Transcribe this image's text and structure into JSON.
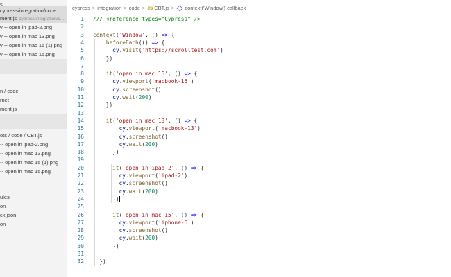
{
  "sidebar": {
    "items": [
      {
        "label": "s",
        "desc": ""
      },
      {
        "label": "cypress/integration/code",
        "desc": ""
      },
      {
        "label": "ment.js",
        "desc": "cypress/integration/c..."
      },
      {
        "label": "v -- open in ipad-2.png",
        "desc": ""
      },
      {
        "label": "v -- open in mac 13.png",
        "desc": ""
      },
      {
        "label": "v -- open in mac 15 (1).png",
        "desc": ""
      },
      {
        "label": "v -- open in mac 15.png",
        "desc": ""
      },
      {
        "label": "n / code",
        "desc": ""
      },
      {
        "label": "rnet",
        "desc": ""
      },
      {
        "label": "ment.js",
        "desc": ""
      },
      {
        "label": "ots / code / CBT.js",
        "desc": ""
      },
      {
        "label": "-- open in ipad-2.png",
        "desc": ""
      },
      {
        "label": "-- open in mac 13.png",
        "desc": ""
      },
      {
        "label": "-- open in mac 15 (1).png",
        "desc": ""
      },
      {
        "label": "-- open in mac 15.png",
        "desc": ""
      },
      {
        "label": "ules",
        "desc": ""
      },
      {
        "label": "on",
        "desc": ""
      },
      {
        "label": "ck.json",
        "desc": ""
      },
      {
        "label": "on",
        "desc": ""
      }
    ]
  },
  "breadcrumb": {
    "parts": [
      "cypress",
      "integration",
      "code",
      "CBT.js",
      "context('Window') callback"
    ],
    "file_icon": "JS"
  },
  "editor": {
    "lines": [
      {
        "n": "1",
        "tokens": [
          {
            "c": "t-com",
            "t": "/// <reference types=\"Cypress\" />"
          }
        ]
      },
      {
        "n": "2",
        "tokens": []
      },
      {
        "n": "3",
        "tokens": [
          {
            "c": "t-fn",
            "t": "context"
          },
          {
            "c": "",
            "t": "("
          },
          {
            "c": "t-str",
            "t": "'Window'"
          },
          {
            "c": "",
            "t": ", () "
          },
          {
            "c": "t-kw",
            "t": "=>"
          },
          {
            "c": "",
            "t": " {"
          }
        ]
      },
      {
        "n": "4",
        "tokens": [
          {
            "c": "",
            "t": "    "
          },
          {
            "c": "t-fn",
            "t": "beforeEach"
          },
          {
            "c": "",
            "t": "(() "
          },
          {
            "c": "t-kw",
            "t": "=>"
          },
          {
            "c": "",
            "t": " {"
          }
        ]
      },
      {
        "n": "5",
        "tokens": [
          {
            "c": "",
            "t": "      "
          },
          {
            "c": "t-var",
            "t": "cy"
          },
          {
            "c": "",
            "t": "."
          },
          {
            "c": "t-fn",
            "t": "visit"
          },
          {
            "c": "",
            "t": "("
          },
          {
            "c": "t-str",
            "t": "'"
          },
          {
            "c": "t-url",
            "t": "https://scrolltest.com"
          },
          {
            "c": "t-str",
            "t": "'"
          },
          {
            "c": "",
            "t": ")"
          }
        ]
      },
      {
        "n": "6",
        "tokens": [
          {
            "c": "",
            "t": "    })"
          }
        ]
      },
      {
        "n": "7",
        "tokens": []
      },
      {
        "n": "8",
        "tokens": [
          {
            "c": "",
            "t": "    "
          },
          {
            "c": "t-fn",
            "t": "it"
          },
          {
            "c": "",
            "t": "("
          },
          {
            "c": "t-str",
            "t": "'open in mac 15'"
          },
          {
            "c": "",
            "t": ", () "
          },
          {
            "c": "t-kw",
            "t": "=>"
          },
          {
            "c": "",
            "t": " {"
          }
        ]
      },
      {
        "n": "9",
        "tokens": [
          {
            "c": "",
            "t": "      "
          },
          {
            "c": "t-var",
            "t": "cy"
          },
          {
            "c": "",
            "t": "."
          },
          {
            "c": "t-fn",
            "t": "viewport"
          },
          {
            "c": "",
            "t": "("
          },
          {
            "c": "t-str",
            "t": "'macbook-15'"
          },
          {
            "c": "",
            "t": ")"
          }
        ]
      },
      {
        "n": "10",
        "tokens": [
          {
            "c": "",
            "t": "      "
          },
          {
            "c": "t-var",
            "t": "cy"
          },
          {
            "c": "",
            "t": "."
          },
          {
            "c": "t-fn",
            "t": "screenshot"
          },
          {
            "c": "",
            "t": "()"
          }
        ]
      },
      {
        "n": "11",
        "tokens": [
          {
            "c": "",
            "t": "      "
          },
          {
            "c": "t-var",
            "t": "cy"
          },
          {
            "c": "",
            "t": "."
          },
          {
            "c": "t-fn",
            "t": "wait"
          },
          {
            "c": "",
            "t": "("
          },
          {
            "c": "t-num",
            "t": "200"
          },
          {
            "c": "",
            "t": ")"
          }
        ]
      },
      {
        "n": "12",
        "tokens": [
          {
            "c": "",
            "t": "    })"
          }
        ]
      },
      {
        "n": "13",
        "tokens": []
      },
      {
        "n": "14",
        "tokens": [
          {
            "c": "",
            "t": "    "
          },
          {
            "c": "t-fn",
            "t": "it"
          },
          {
            "c": "",
            "t": "("
          },
          {
            "c": "t-str",
            "t": "'open in mac 13'"
          },
          {
            "c": "",
            "t": ", () "
          },
          {
            "c": "t-kw",
            "t": "=>"
          },
          {
            "c": "",
            "t": " {"
          }
        ]
      },
      {
        "n": "15",
        "tokens": [
          {
            "c": "",
            "t": "        "
          },
          {
            "c": "t-var",
            "t": "cy"
          },
          {
            "c": "",
            "t": "."
          },
          {
            "c": "t-fn",
            "t": "viewport"
          },
          {
            "c": "",
            "t": "("
          },
          {
            "c": "t-str",
            "t": "'macbook-13'"
          },
          {
            "c": "",
            "t": ")"
          }
        ]
      },
      {
        "n": "16",
        "tokens": [
          {
            "c": "",
            "t": "        "
          },
          {
            "c": "t-var",
            "t": "cy"
          },
          {
            "c": "",
            "t": "."
          },
          {
            "c": "t-fn",
            "t": "screenshot"
          },
          {
            "c": "",
            "t": "()"
          }
        ]
      },
      {
        "n": "17",
        "tokens": [
          {
            "c": "",
            "t": "        "
          },
          {
            "c": "t-var",
            "t": "cy"
          },
          {
            "c": "",
            "t": "."
          },
          {
            "c": "t-fn",
            "t": "wait"
          },
          {
            "c": "",
            "t": "("
          },
          {
            "c": "t-num",
            "t": "200"
          },
          {
            "c": "",
            "t": ")"
          }
        ]
      },
      {
        "n": "18",
        "tokens": [
          {
            "c": "",
            "t": "      })"
          }
        ]
      },
      {
        "n": "19",
        "tokens": []
      },
      {
        "n": "20",
        "tokens": [
          {
            "c": "",
            "t": "      "
          },
          {
            "c": "t-fn",
            "t": "it"
          },
          {
            "c": "",
            "t": "("
          },
          {
            "c": "t-str",
            "t": "'open in ipad-2'"
          },
          {
            "c": "",
            "t": ", () "
          },
          {
            "c": "t-kw",
            "t": "=>"
          },
          {
            "c": "",
            "t": " {"
          }
        ]
      },
      {
        "n": "21",
        "tokens": [
          {
            "c": "",
            "t": "        "
          },
          {
            "c": "t-var",
            "t": "cy"
          },
          {
            "c": "",
            "t": "."
          },
          {
            "c": "t-fn",
            "t": "viewport"
          },
          {
            "c": "",
            "t": "("
          },
          {
            "c": "t-str",
            "t": "'ipad-2'"
          },
          {
            "c": "",
            "t": ")"
          }
        ]
      },
      {
        "n": "22",
        "tokens": [
          {
            "c": "",
            "t": "        "
          },
          {
            "c": "t-var",
            "t": "cy"
          },
          {
            "c": "",
            "t": "."
          },
          {
            "c": "t-fn",
            "t": "screenshot"
          },
          {
            "c": "",
            "t": "()"
          }
        ]
      },
      {
        "n": "23",
        "tokens": [
          {
            "c": "",
            "t": "        "
          },
          {
            "c": "t-var",
            "t": "cy"
          },
          {
            "c": "",
            "t": "."
          },
          {
            "c": "t-fn",
            "t": "wait"
          },
          {
            "c": "",
            "t": "("
          },
          {
            "c": "t-num",
            "t": "200"
          },
          {
            "c": "",
            "t": ")"
          }
        ]
      },
      {
        "n": "24",
        "tokens": [
          {
            "c": "",
            "t": "      })"
          }
        ],
        "cursor": true
      },
      {
        "n": "25",
        "tokens": []
      },
      {
        "n": "26",
        "tokens": [
          {
            "c": "",
            "t": "      "
          },
          {
            "c": "t-fn",
            "t": "it"
          },
          {
            "c": "",
            "t": "("
          },
          {
            "c": "t-str",
            "t": "'open in mac 15'"
          },
          {
            "c": "",
            "t": ", () "
          },
          {
            "c": "t-kw",
            "t": "=>"
          },
          {
            "c": "",
            "t": " {"
          }
        ]
      },
      {
        "n": "27",
        "tokens": [
          {
            "c": "",
            "t": "        "
          },
          {
            "c": "t-var",
            "t": "cy"
          },
          {
            "c": "",
            "t": "."
          },
          {
            "c": "t-fn",
            "t": "viewport"
          },
          {
            "c": "",
            "t": "("
          },
          {
            "c": "t-str",
            "t": "'iphone-6'"
          },
          {
            "c": "",
            "t": ")"
          }
        ]
      },
      {
        "n": "28",
        "tokens": [
          {
            "c": "",
            "t": "        "
          },
          {
            "c": "t-var",
            "t": "cy"
          },
          {
            "c": "",
            "t": "."
          },
          {
            "c": "t-fn",
            "t": "screenshot"
          },
          {
            "c": "",
            "t": "()"
          }
        ]
      },
      {
        "n": "29",
        "tokens": [
          {
            "c": "",
            "t": "        "
          },
          {
            "c": "t-var",
            "t": "cy"
          },
          {
            "c": "",
            "t": "."
          },
          {
            "c": "t-fn",
            "t": "wait"
          },
          {
            "c": "",
            "t": "("
          },
          {
            "c": "t-num",
            "t": "200"
          },
          {
            "c": "",
            "t": ")"
          }
        ]
      },
      {
        "n": "30",
        "tokens": [
          {
            "c": "",
            "t": "      })"
          }
        ]
      },
      {
        "n": "31",
        "tokens": []
      },
      {
        "n": "32",
        "tokens": [
          {
            "c": "",
            "t": "  })"
          }
        ]
      }
    ]
  },
  "colors": {
    "line_number": "#237893",
    "keyword": "#0000ff",
    "string": "#a31515",
    "function": "#795e26",
    "variable": "#001080",
    "comment": "#008000",
    "number": "#098658"
  }
}
